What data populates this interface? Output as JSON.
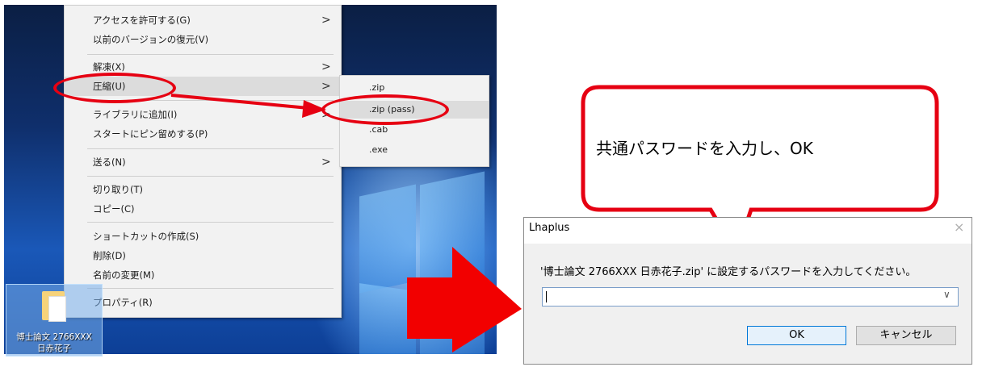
{
  "context_menu": {
    "items": [
      {
        "label": "アクセスを許可する(G)",
        "arrow": true
      },
      {
        "label": "以前のバージョンの復元(V)",
        "arrow": false
      },
      {
        "label": "解凍(X)",
        "arrow": true
      },
      {
        "label": "圧縮(U)",
        "arrow": true
      },
      {
        "label": "ライブラリに追加(I)",
        "arrow": true
      },
      {
        "label": "スタートにピン留めする(P)",
        "arrow": false
      },
      {
        "label": "送る(N)",
        "arrow": true
      },
      {
        "label": "切り取り(T)",
        "arrow": false
      },
      {
        "label": "コピー(C)",
        "arrow": false
      },
      {
        "label": "ショートカットの作成(S)",
        "arrow": false
      },
      {
        "label": "削除(D)",
        "arrow": false
      },
      {
        "label": "名前の変更(M)",
        "arrow": false
      },
      {
        "label": "プロパティ(R)",
        "arrow": false
      }
    ],
    "arrow_glyph": ">"
  },
  "compress_submenu": {
    "items": [
      ".zip",
      ".zip (pass)",
      ".cab",
      ".exe"
    ]
  },
  "desktop_icon": {
    "label_line1": "博士論文 2766XXX",
    "label_line2": "日赤花子"
  },
  "callout": {
    "text": "共通パスワードを入力し、OK"
  },
  "dialog": {
    "title": "Lhaplus",
    "close_glyph": "×",
    "prompt": "'博士論文 2766XXX 日赤花子.zip' に設定するパスワードを入力してください。",
    "password_value": "",
    "ok_label": "OK",
    "cancel_label": "キャンセル"
  },
  "colors": {
    "annotation_red": "#e60012",
    "menu_bg": "#f2f2f2",
    "highlight": "#dcdcdc",
    "ok_border": "#0078d7"
  }
}
